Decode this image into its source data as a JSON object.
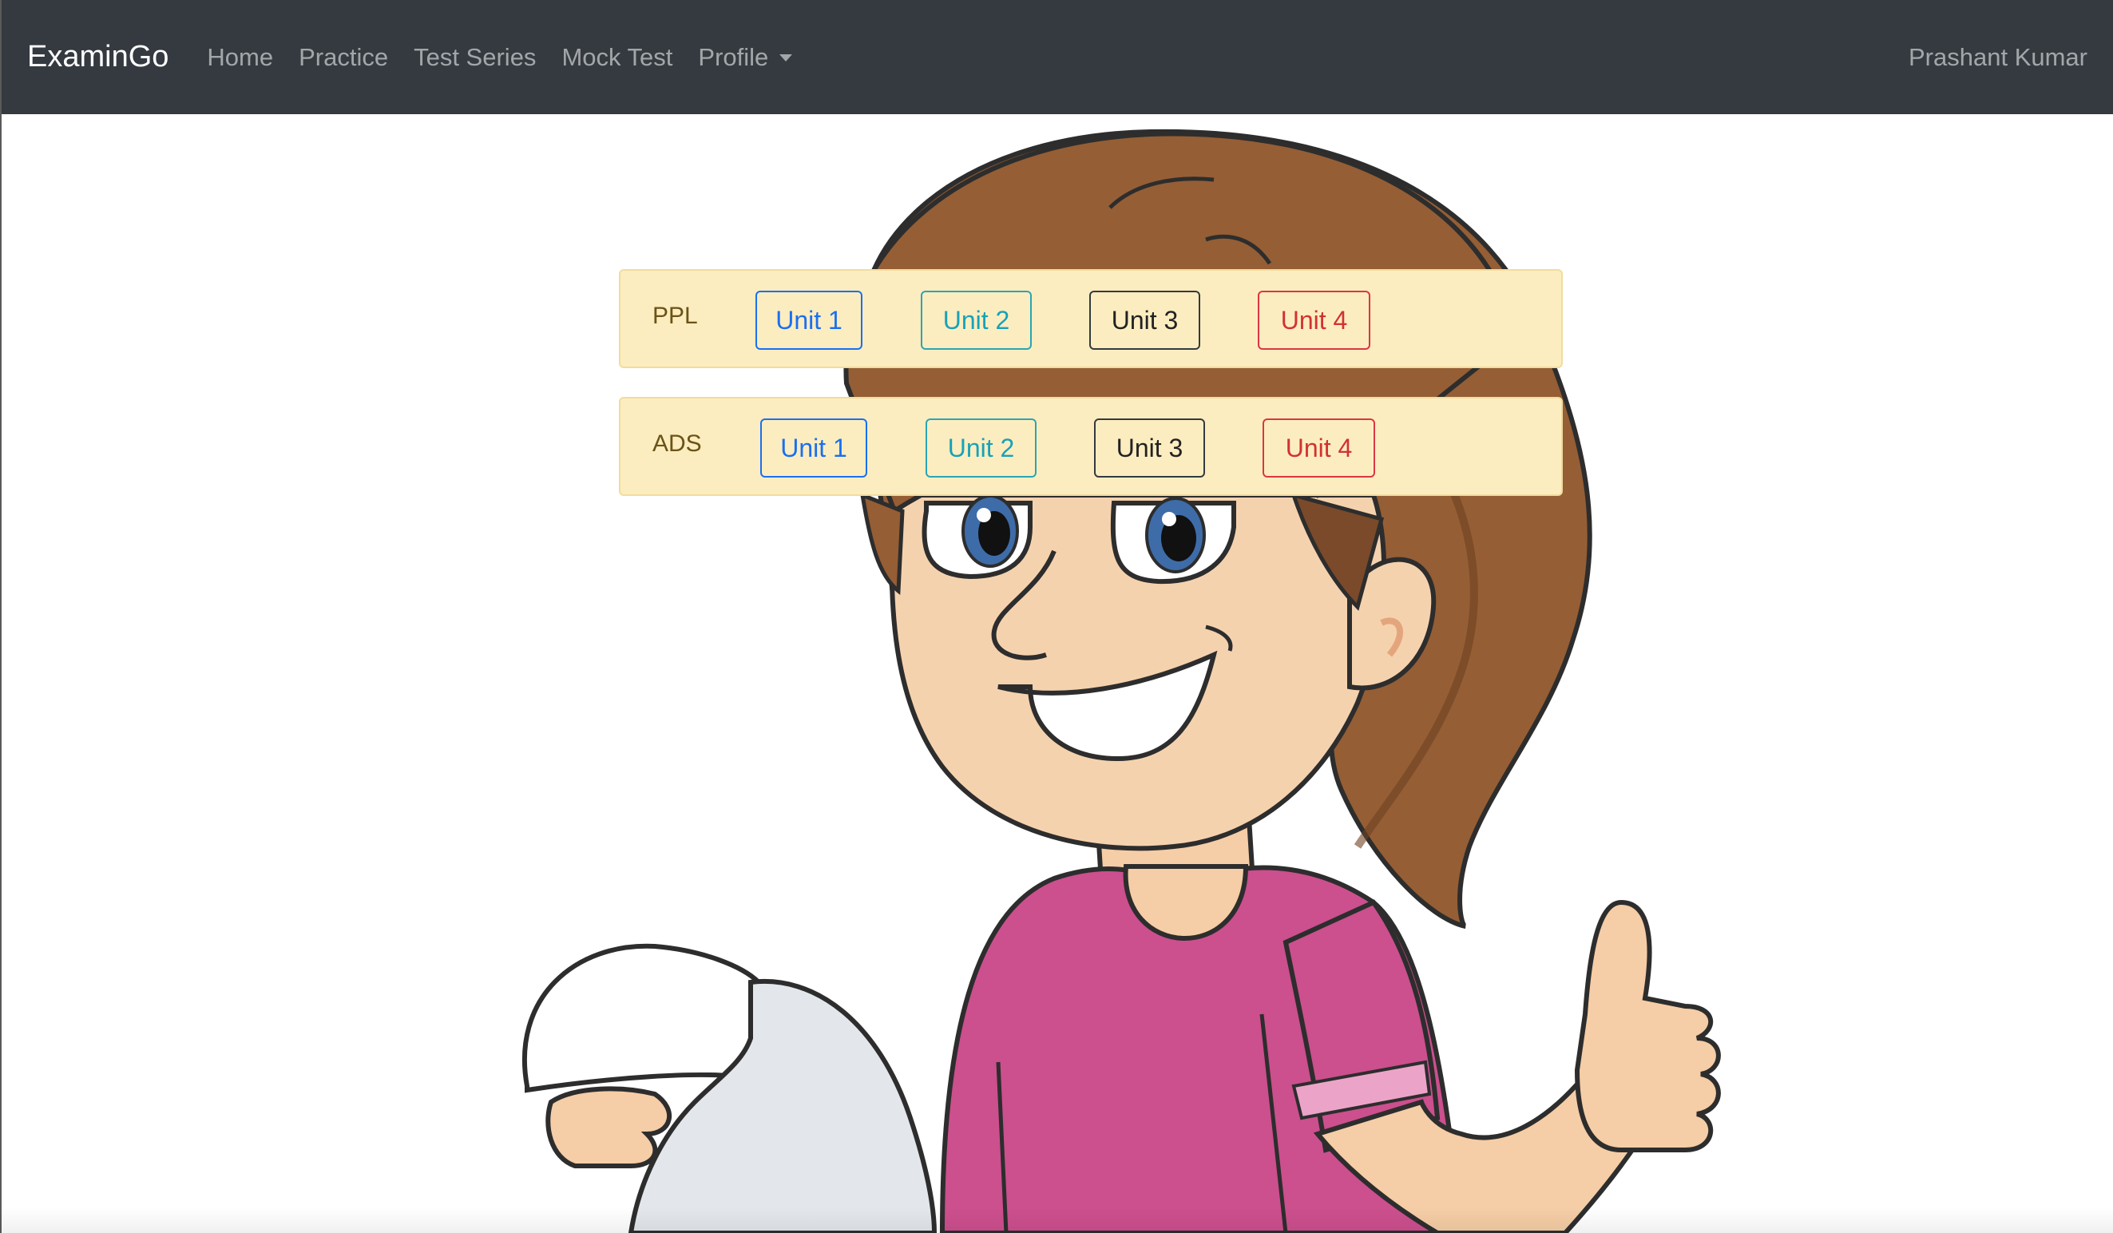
{
  "navbar": {
    "brand": "ExaminGo",
    "links": [
      {
        "label": "Home"
      },
      {
        "label": "Practice"
      },
      {
        "label": "Test Series"
      },
      {
        "label": "Mock Test"
      }
    ],
    "dropdown_label": "Profile",
    "user_name": "Prashant Kumar",
    "background": "#343a40"
  },
  "subjects": [
    {
      "name": "PPL",
      "units": [
        "Unit 1",
        "Unit 2",
        "Unit 3",
        "Unit 4"
      ]
    },
    {
      "name": "ADS",
      "units": [
        "Unit 1",
        "Unit 2",
        "Unit 3",
        "Unit 4"
      ]
    }
  ],
  "colors": {
    "card_background": "#fcedc0",
    "unit1": "#1a6ff2",
    "unit2": "#17a2b8",
    "unit3": "#343a40",
    "unit4": "#dc3545"
  },
  "illustration": {
    "icon": "cartoon-girl-thumbs-up-holding-paper"
  }
}
